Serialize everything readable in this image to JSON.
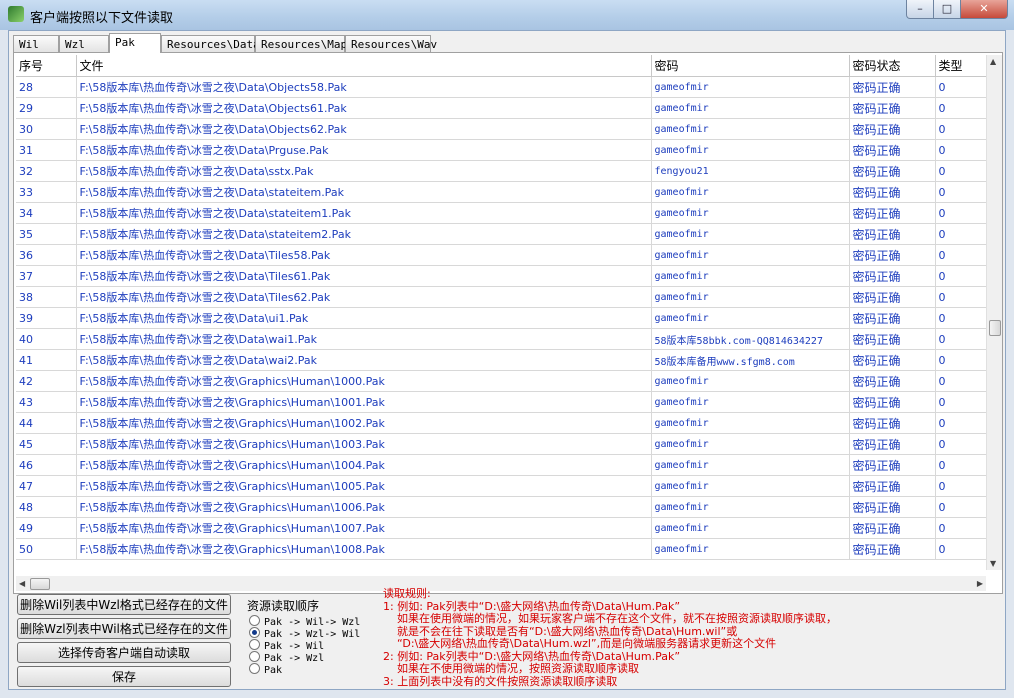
{
  "window": {
    "title": "客户端按照以下文件读取"
  },
  "tabs": [
    "Wil",
    "Wzl",
    "Pak",
    "Resources\\Data",
    "Resources\\Map",
    "Resources\\Wav"
  ],
  "table": {
    "headers": [
      "序号",
      "文件",
      "密码",
      "密码状态",
      "类型"
    ],
    "rows": [
      [
        "28",
        "F:\\58版本库\\热血传奇\\冰雪之夜\\Data\\Objects58.Pak",
        "gameofmir",
        "密码正确",
        "0"
      ],
      [
        "29",
        "F:\\58版本库\\热血传奇\\冰雪之夜\\Data\\Objects61.Pak",
        "gameofmir",
        "密码正确",
        "0"
      ],
      [
        "30",
        "F:\\58版本库\\热血传奇\\冰雪之夜\\Data\\Objects62.Pak",
        "gameofmir",
        "密码正确",
        "0"
      ],
      [
        "31",
        "F:\\58版本库\\热血传奇\\冰雪之夜\\Data\\Prguse.Pak",
        "gameofmir",
        "密码正确",
        "0"
      ],
      [
        "32",
        "F:\\58版本库\\热血传奇\\冰雪之夜\\Data\\sstx.Pak",
        "fengyou21",
        "密码正确",
        "0"
      ],
      [
        "33",
        "F:\\58版本库\\热血传奇\\冰雪之夜\\Data\\stateitem.Pak",
        "gameofmir",
        "密码正确",
        "0"
      ],
      [
        "34",
        "F:\\58版本库\\热血传奇\\冰雪之夜\\Data\\stateitem1.Pak",
        "gameofmir",
        "密码正确",
        "0"
      ],
      [
        "35",
        "F:\\58版本库\\热血传奇\\冰雪之夜\\Data\\stateitem2.Pak",
        "gameofmir",
        "密码正确",
        "0"
      ],
      [
        "36",
        "F:\\58版本库\\热血传奇\\冰雪之夜\\Data\\Tiles58.Pak",
        "gameofmir",
        "密码正确",
        "0"
      ],
      [
        "37",
        "F:\\58版本库\\热血传奇\\冰雪之夜\\Data\\Tiles61.Pak",
        "gameofmir",
        "密码正确",
        "0"
      ],
      [
        "38",
        "F:\\58版本库\\热血传奇\\冰雪之夜\\Data\\Tiles62.Pak",
        "gameofmir",
        "密码正确",
        "0"
      ],
      [
        "39",
        "F:\\58版本库\\热血传奇\\冰雪之夜\\Data\\ui1.Pak",
        "gameofmir",
        "密码正确",
        "0"
      ],
      [
        "40",
        "F:\\58版本库\\热血传奇\\冰雪之夜\\Data\\wai1.Pak",
        "58版本库58bbk.com-QQ814634227",
        "密码正确",
        "0"
      ],
      [
        "41",
        "F:\\58版本库\\热血传奇\\冰雪之夜\\Data\\wai2.Pak",
        "58版本库备用www.sfgm8.com",
        "密码正确",
        "0"
      ],
      [
        "42",
        "F:\\58版本库\\热血传奇\\冰雪之夜\\Graphics\\Human\\1000.Pak",
        "gameofmir",
        "密码正确",
        "0"
      ],
      [
        "43",
        "F:\\58版本库\\热血传奇\\冰雪之夜\\Graphics\\Human\\1001.Pak",
        "gameofmir",
        "密码正确",
        "0"
      ],
      [
        "44",
        "F:\\58版本库\\热血传奇\\冰雪之夜\\Graphics\\Human\\1002.Pak",
        "gameofmir",
        "密码正确",
        "0"
      ],
      [
        "45",
        "F:\\58版本库\\热血传奇\\冰雪之夜\\Graphics\\Human\\1003.Pak",
        "gameofmir",
        "密码正确",
        "0"
      ],
      [
        "46",
        "F:\\58版本库\\热血传奇\\冰雪之夜\\Graphics\\Human\\1004.Pak",
        "gameofmir",
        "密码正确",
        "0"
      ],
      [
        "47",
        "F:\\58版本库\\热血传奇\\冰雪之夜\\Graphics\\Human\\1005.Pak",
        "gameofmir",
        "密码正确",
        "0"
      ],
      [
        "48",
        "F:\\58版本库\\热血传奇\\冰雪之夜\\Graphics\\Human\\1006.Pak",
        "gameofmir",
        "密码正确",
        "0"
      ],
      [
        "49",
        "F:\\58版本库\\热血传奇\\冰雪之夜\\Graphics\\Human\\1007.Pak",
        "gameofmir",
        "密码正确",
        "0"
      ],
      [
        "50",
        "F:\\58版本库\\热血传奇\\冰雪之夜\\Graphics\\Human\\1008.Pak",
        "gameofmir",
        "密码正确",
        "0"
      ]
    ]
  },
  "buttons": {
    "delete_wil": "删除Wil列表中Wzl格式已经存在的文件",
    "delete_wzl": "删除Wzl列表中Wil格式已经存在的文件",
    "select_client": "选择传奇客户端自动读取",
    "save": "保存"
  },
  "order_group": {
    "title": "资源读取顺序",
    "options": [
      "Pak -> Wil-> Wzl",
      "Pak -> Wzl-> Wil",
      "Pak -> Wil",
      "Pak -> Wzl",
      "Pak"
    ],
    "selected_index": 1
  },
  "rules": {
    "lines": [
      "读取规则:",
      "1: 例如: Pak列表中“D:\\盛大网络\\热血传奇\\Data\\Hum.Pak”",
      "    如果在使用微端的情况，如果玩家客户端不存在这个文件，就不在按照资源读取顺序读取，",
      "    就是不会在往下读取是否有“D:\\盛大网络\\热血传奇\\Data\\Hum.wil”或",
      "    “D:\\盛大网络\\热血传奇\\Data\\Hum.wzl”,而是向微端服务器请求更新这个文件",
      "2: 例如: Pak列表中“D:\\盛大网络\\热血传奇\\Data\\Hum.Pak”",
      "    如果在不使用微端的情况，按照资源读取顺序读取",
      "3: 上面列表中没有的文件按照资源读取顺序读取"
    ]
  },
  "colors": {
    "link_blue": "#1d3dbd",
    "rules_red": "#d60000"
  }
}
